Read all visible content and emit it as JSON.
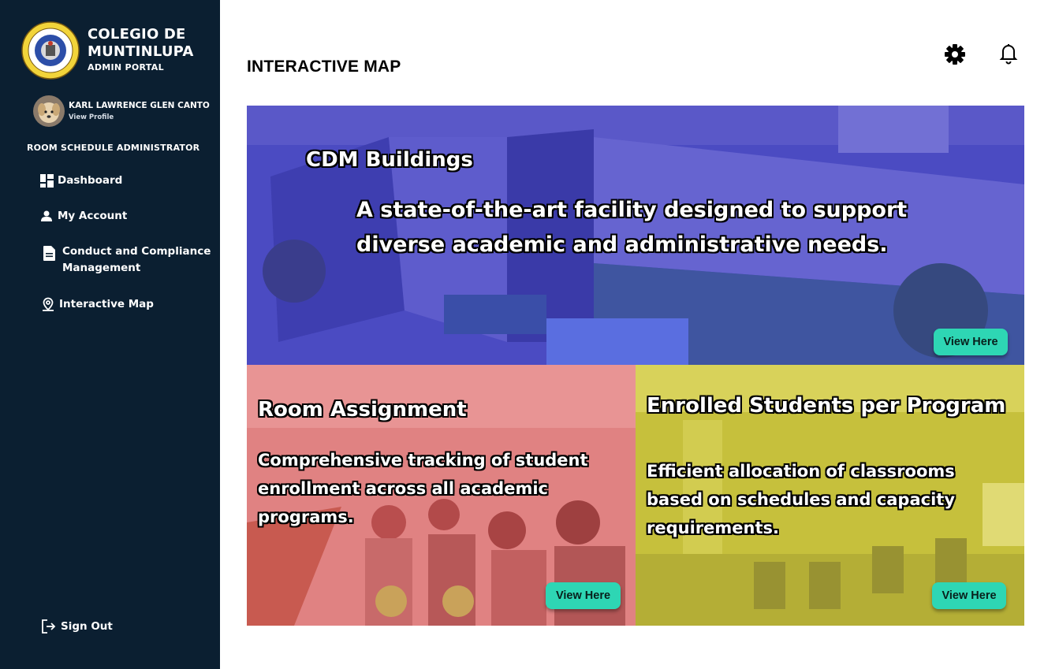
{
  "sidebar": {
    "brand_name": "COLEGIO DE MUNTINLUPA",
    "brand_sub": "ADMIN PORTAL",
    "profile_name": "KARL LAWRENCE GLEN CANTO",
    "profile_link": "View Profile",
    "role": "ROOM SCHEDULE ADMINISTRATOR",
    "nav": [
      {
        "label": "Dashboard",
        "icon": "dashboard-icon"
      },
      {
        "label": "My Account",
        "icon": "user-icon"
      },
      {
        "label": "Conduct and Compliance Management",
        "icon": "document-icon"
      },
      {
        "label": "Interactive Map",
        "icon": "map-pin-icon"
      }
    ],
    "sign_out": "Sign Out"
  },
  "header": {
    "title": "INTERACTIVE MAP",
    "icons": [
      "gear-icon",
      "bell-icon"
    ]
  },
  "cards": [
    {
      "title": "CDM Buildings",
      "text": "A state-of-the-art facility designed to support diverse academic and administrative needs.",
      "button": "View Here",
      "overlay_color": "#4a4ac4"
    },
    {
      "title": "Room Assignment",
      "text": "Comprehensive tracking of student enrollment across all academic programs.",
      "button": "View Here",
      "overlay_color": "#e07b7c"
    },
    {
      "title": "Enrolled Students per Program",
      "text": "Efficient allocation of classrooms based on schedules and capacity requirements.",
      "button": "View Here",
      "overlay_color": "#c7c13a"
    }
  ],
  "colors": {
    "sidebar_bg": "#0b1f31",
    "button_bg": "#2ed6b4",
    "page_bg": "#ffffff"
  }
}
